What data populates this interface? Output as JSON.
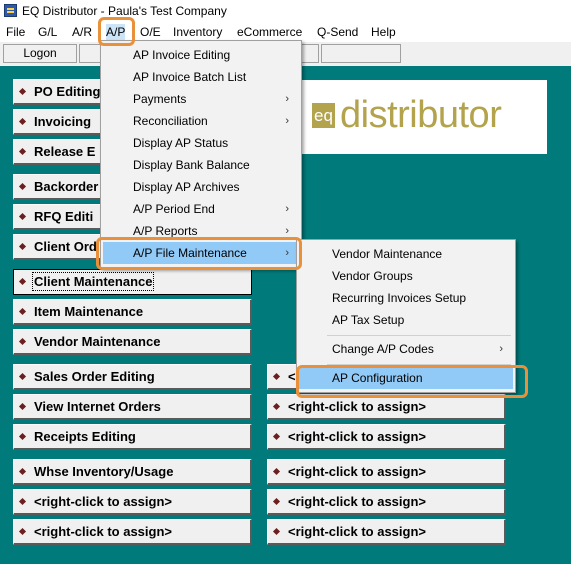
{
  "window": {
    "title": "EQ Distributor - Paula's Test Company"
  },
  "menubar": [
    "File",
    "G/L",
    "A/R",
    "A/P",
    "O/E",
    "Inventory",
    "eCommerce",
    "Q-Send",
    "Help"
  ],
  "toolbar": {
    "logon_label": "Logon"
  },
  "logo": {
    "mark": "eq",
    "word": "distributor"
  },
  "left_buttons": [
    "PO Editing",
    "Invoicing",
    "Release E",
    "Backorder",
    "RFQ Editi",
    "Client Ord",
    "Client Maintenance",
    "Item Maintenance",
    "Vendor Maintenance",
    "Sales Order Editing",
    "View Internet Orders",
    "Receipts Editing",
    "Whse Inventory/Usage",
    "<right-click to assign>",
    "<right-click to assign>"
  ],
  "right_buttons": [
    "<",
    "<right-click to assign>",
    "<right-click to assign>",
    "<right-click to assign>",
    "<right-click to assign>",
    "<right-click to assign>"
  ],
  "ap_menu": {
    "items": [
      {
        "label": "AP Invoice Editing",
        "arrow": ""
      },
      {
        "label": "AP Invoice Batch List",
        "arrow": ""
      },
      {
        "label": "Payments",
        "arrow": "›"
      },
      {
        "label": "Reconciliation",
        "arrow": "›"
      },
      {
        "label": "Display AP Status",
        "arrow": ""
      },
      {
        "label": "Display Bank Balance",
        "arrow": ""
      },
      {
        "label": "Display AP Archives",
        "arrow": ""
      },
      {
        "label": "A/P Period End",
        "arrow": "›"
      },
      {
        "label": "A/P Reports",
        "arrow": "›"
      },
      {
        "label": "A/P File Maintenance",
        "arrow": "›"
      }
    ]
  },
  "file_maint_menu": {
    "items": [
      {
        "label": "Vendor Maintenance",
        "arrow": ""
      },
      {
        "label": "Vendor Groups",
        "arrow": ""
      },
      {
        "label": "Recurring Invoices Setup",
        "arrow": ""
      },
      {
        "label": "AP Tax Setup",
        "arrow": ""
      },
      {
        "label": "Change A/P Codes",
        "arrow": "›"
      },
      {
        "label": "AP Configuration",
        "arrow": ""
      }
    ]
  },
  "colors": {
    "background": "#007a7a",
    "highlight": "#e8913a",
    "selection": "#91c9f7",
    "logo": "#b2a34c"
  }
}
